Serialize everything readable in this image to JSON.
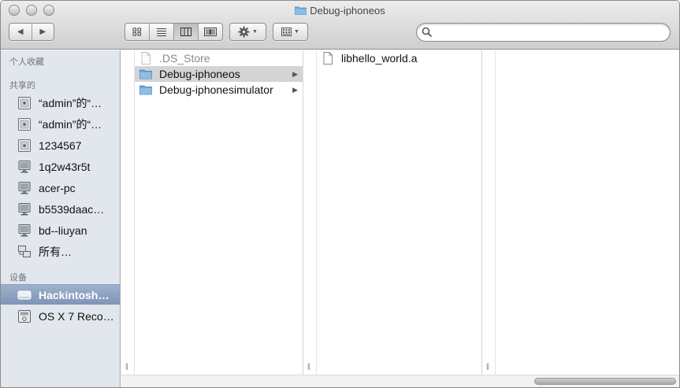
{
  "window": {
    "title": "Debug-iphoneos"
  },
  "toolbar": {
    "back_icon": "back-arrow-icon",
    "forward_icon": "forward-arrow-icon",
    "views": [
      "icon-view",
      "list-view",
      "column-view",
      "coverflow-view"
    ],
    "selected_view": "column-view",
    "action_icon": "gear-icon",
    "arrange_icon": "arrange-grid-icon",
    "search": {
      "value": "",
      "placeholder": ""
    }
  },
  "sidebar": {
    "favorites_header": "个人收藏",
    "shared_header": "共享的",
    "shared_items": [
      {
        "label": "“admin”的“…",
        "icon": "server-icon"
      },
      {
        "label": "“admin”的“…",
        "icon": "server-icon"
      },
      {
        "label": "1234567",
        "icon": "server-icon"
      },
      {
        "label": "1q2w43r5t",
        "icon": "monitor-icon"
      },
      {
        "label": "acer-pc",
        "icon": "monitor-icon"
      },
      {
        "label": "b5539daac…",
        "icon": "monitor-icon"
      },
      {
        "label": "bd--liuyan",
        "icon": "monitor-icon"
      },
      {
        "label": "所有…",
        "icon": "network-icon"
      }
    ],
    "devices_header": "设备",
    "device_items": [
      {
        "label": "Hackintosh…",
        "icon": "hard-drive-icon",
        "selected": true
      },
      {
        "label": "OS X 7 Reco…",
        "icon": "disk-icon",
        "selected": false
      }
    ]
  },
  "columns": {
    "col1": [
      {
        "name": ".DS_Store",
        "kind": "file",
        "dimmed": true
      },
      {
        "name": "Debug-iphoneos",
        "kind": "folder",
        "selected": true
      },
      {
        "name": "Debug-iphonesimulator",
        "kind": "folder"
      }
    ],
    "col2": [
      {
        "name": "libhello_world.a",
        "kind": "file"
      }
    ]
  },
  "colors": {
    "sidebar_bg": "#e2e7ed",
    "selected_sidebar": "#8a9fbd",
    "folder_blue": "#6fa3d8"
  }
}
